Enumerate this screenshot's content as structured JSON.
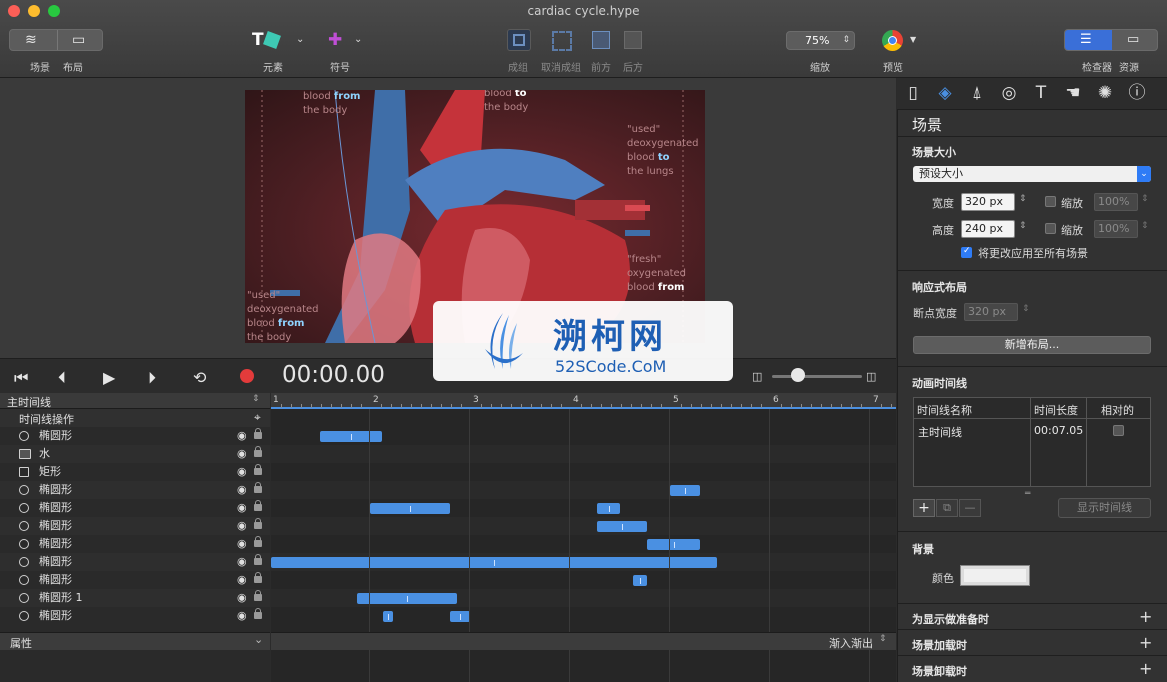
{
  "window": {
    "title": "cardiac cycle.hype"
  },
  "toolbar": {
    "scene_label": "场景",
    "layout_label": "布局",
    "elements_label": "元素",
    "symbols_label": "符号",
    "group_label": "成组",
    "ungroup_label": "取消成组",
    "front_label": "前方",
    "back_label": "后方",
    "zoom_value": "75%",
    "zoom_label": "缩放",
    "preview_label": "预览",
    "inspector_label": "检查器",
    "resources_label": "资源"
  },
  "stage": {
    "texts": {
      "blood_from_top_1": "blood",
      "blood_from_top_2": "from",
      "blood_from_top_3": "the body",
      "blood_to_top_1": "blood",
      "blood_to_top_2": "to",
      "blood_to_top_3": "the body",
      "used_r_1": "\"used\"",
      "used_r_2": "deoxygenated",
      "used_r_3": "blood",
      "used_r_4": "to",
      "used_r_5": "the lungs",
      "fresh_1": "\"fresh\"",
      "fresh_2": "oxygenated",
      "fresh_3": "blood",
      "fresh_4": "from",
      "used_l_1": "\"used\"",
      "used_l_2": "deoxygenated",
      "used_l_3": "blood",
      "used_l_4": "from",
      "used_l_5": "the body"
    }
  },
  "watermark": {
    "title": "溯柯网",
    "url": "52SCode.CoM"
  },
  "transport": {
    "timecode": "00:00.00"
  },
  "timeline": {
    "main_timeline": "主时间线",
    "actions_label": "时间线操作",
    "properties_label": "属性",
    "easing_label": "渐入渐出",
    "ruler_ticks": [
      "1",
      "2",
      "3",
      "4",
      "5",
      "6",
      "7"
    ],
    "layers": [
      {
        "name": "椭圆形",
        "icon": "circle"
      },
      {
        "name": "水",
        "icon": "image"
      },
      {
        "name": "矩形",
        "icon": "square"
      },
      {
        "name": "椭圆形",
        "icon": "circle"
      },
      {
        "name": "椭圆形",
        "icon": "circle"
      },
      {
        "name": "椭圆形",
        "icon": "circle"
      },
      {
        "name": "椭圆形",
        "icon": "circle"
      },
      {
        "name": "椭圆形",
        "icon": "circle"
      },
      {
        "name": "椭圆形",
        "icon": "circle"
      },
      {
        "name": "椭圆形 1",
        "icon": "circle"
      },
      {
        "name": "椭圆形",
        "icon": "circle"
      }
    ]
  },
  "inspector": {
    "section_title": "场景",
    "scene_size_label": "场景大小",
    "preset_value": "预设大小",
    "width_label": "宽度",
    "width_value": "320 px",
    "height_label": "高度",
    "height_value": "240 px",
    "scale_label": "缩放",
    "scale_value": "100%",
    "apply_all_label": "将更改应用至所有场景",
    "responsive_label": "响应式布局",
    "breakpoint_label": "断点宽度",
    "breakpoint_value": "320 px",
    "new_layout_button": "新增布局...",
    "anim_timelines_label": "动画时间线",
    "col_name": "时间线名称",
    "col_duration": "时间长度",
    "col_relative": "相对的",
    "timeline_row_name": "主时间线",
    "timeline_row_duration": "00:07.05",
    "show_timeline_button": "显示时间线",
    "background_label": "背景",
    "color_label": "颜色",
    "prepare_label": "为显示做准备时",
    "load_label": "场景加载时",
    "unload_label": "场景卸载时"
  },
  "colors": {
    "accent": "#4a90e2",
    "record": "#e33b3b"
  }
}
